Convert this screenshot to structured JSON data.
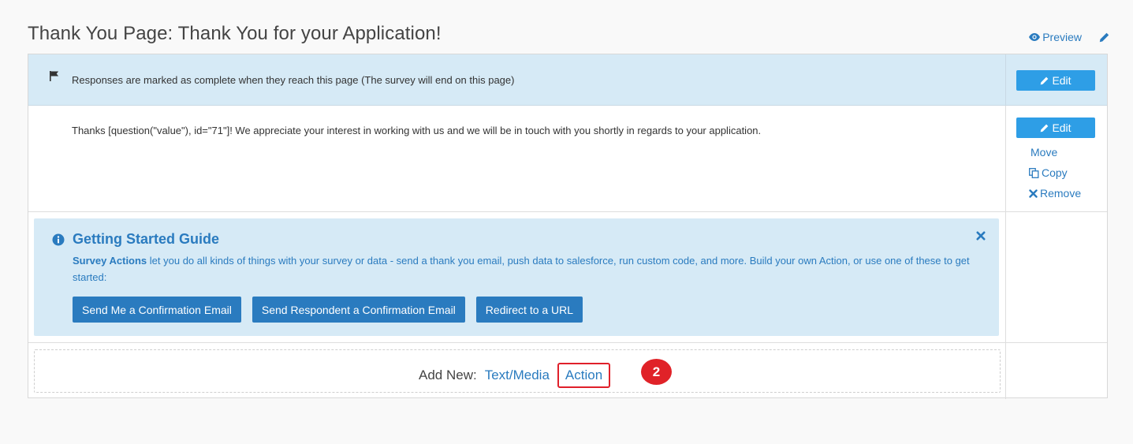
{
  "page": {
    "title": "Thank You Page: Thank You for your Application!"
  },
  "top_actions": {
    "preview_label": "Preview",
    "preview_icon": "eye-icon",
    "edit_icon": "pencil-icon"
  },
  "completion_row": {
    "icon": "flag-icon",
    "text": "Responses are marked as complete when they reach this page (The survey will end on this page)",
    "edit_label": "Edit"
  },
  "text_row": {
    "body": "Thanks [question(\"value\"), id=\"71\"]! We appreciate your interest in working with us and we will be in touch with you shortly in regards to your application.",
    "edit_label": "Edit",
    "move_label": "Move",
    "copy_label": "Copy",
    "remove_label": "Remove"
  },
  "guide": {
    "title": "Getting Started Guide",
    "desc_strong": "Survey Actions",
    "desc_rest": " let you do all kinds of things with your survey or data - send a thank you email, push data to salesforce, run custom code, and more. Build your own Action, or use one of these to get started:",
    "buttons": [
      "Send Me a Confirmation Email",
      "Send Respondent a Confirmation Email",
      "Redirect to a URL"
    ]
  },
  "add_new": {
    "label": "Add New:",
    "text_media": "Text/Media",
    "action": "Action",
    "step_badge": "2"
  },
  "colors": {
    "accent_blue": "#2a7bbf",
    "button_blue": "#2e9ee6",
    "banner_bg": "#d6eaf6",
    "highlight_red": "#e02228"
  }
}
